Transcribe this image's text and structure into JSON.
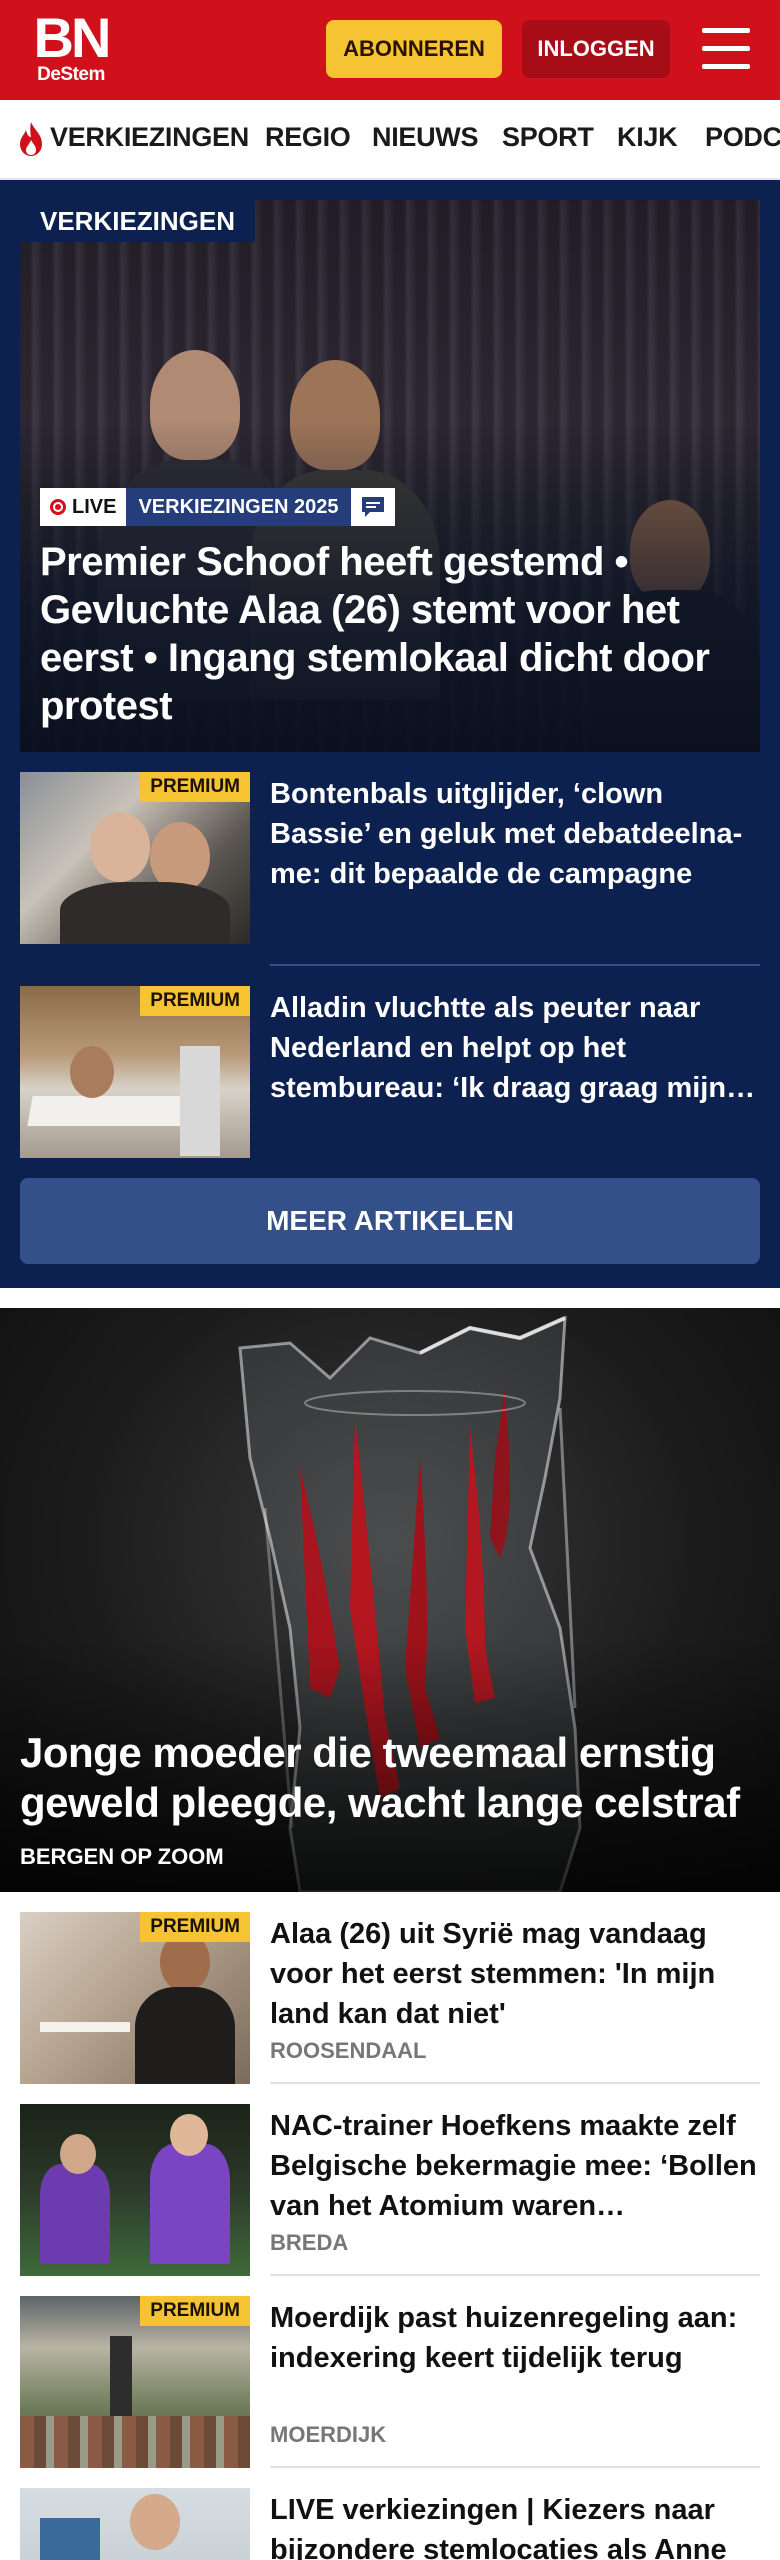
{
  "header": {
    "logo_main": "BN",
    "logo_sub": "DeStem",
    "subscribe_label": "ABONNEREN",
    "login_label": "INLOGGEN",
    "menu_icon": "hamburger-menu-icon",
    "brand_color": "#d0111b"
  },
  "nav": {
    "items": [
      {
        "label": "VERKIEZINGEN",
        "icon": "flame-icon"
      },
      {
        "label": "REGIO"
      },
      {
        "label": "NIEUWS"
      },
      {
        "label": "SPORT"
      },
      {
        "label": "KIJK"
      },
      {
        "label": "PODC"
      }
    ]
  },
  "elections": {
    "section_label": "VERKIEZINGEN",
    "background": "#0d2150",
    "hero": {
      "live_label": "LIVE",
      "topic_label": "VERKIEZINGEN 2025",
      "chat_icon": "chat-bubble-icon",
      "title": "Premier Schoof heeft gestemd • Gevluchte Alaa (26) stemt voor het eerst • Ingang stemlokaal dicht door protest"
    },
    "stories": [
      {
        "badge": "PREMIUM",
        "title": "Bontenbals uitglijder, ‘clown Bassie’ en geluk met debatdeelna­me: dit bepaalde de campagne"
      },
      {
        "badge": "PREMIUM",
        "title": "Alladin vluchtte als peuter naar Nederland en helpt op het stembureau: ‘Ik draag graag mijn…"
      }
    ],
    "more_label": "MEER ARTIKELEN"
  },
  "feature": {
    "title": "Jonge moeder die tweemaal ernstig geweld pleegde, wacht lange celstraf",
    "location": "BERGEN OP ZOOM"
  },
  "news": [
    {
      "badge": "PREMIUM",
      "title": "Alaa (26) uit Syrië mag vandaag voor het eerst stemmen: 'In mijn land kan dat niet'",
      "location": "ROOSENDAAL"
    },
    {
      "badge": "",
      "title": "NAC-trainer Hoefkens maakte zelf Belgische bekermagie mee: ‘Bollen van het Atomium waren…",
      "location": "BREDA"
    },
    {
      "badge": "PREMIUM",
      "title": "Moerdijk past huizenregeling aan: indexering keert tijdelijk terug",
      "location": "MOERDIJK"
    },
    {
      "badge": "",
      "title": "LIVE verkiezingen | Kiezers naar bijzondere stemlocaties als Anne",
      "location": ""
    }
  ]
}
